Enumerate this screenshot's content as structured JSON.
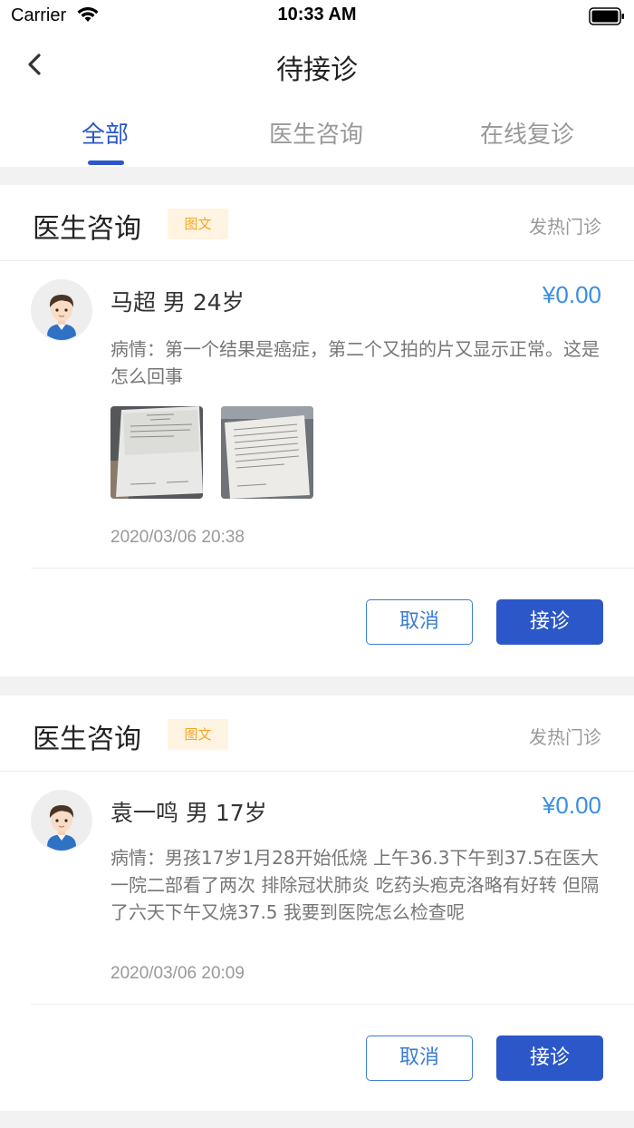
{
  "status": {
    "carrier": "Carrier",
    "time": "10:33 AM"
  },
  "nav": {
    "title": "待接诊",
    "back_icon": "chevron-left-icon"
  },
  "tabs": [
    {
      "label": "全部",
      "active": true
    },
    {
      "label": "医生咨询",
      "active": false
    },
    {
      "label": "在线复诊",
      "active": false
    }
  ],
  "colors": {
    "accent": "#2b57c8",
    "price": "#3a8ee6",
    "tag_bg": "#fff4e1",
    "tag_text": "#f5a623"
  },
  "cards": [
    {
      "type": "医生咨询",
      "tag": "图文",
      "department": "发热门诊",
      "patient": "马超 男 24岁",
      "price": "¥0.00",
      "condition": "病情：第一个结果是癌症，第二个又拍的片又显示正常。这是怎么回事",
      "datetime": "2020/03/06 20:38",
      "cancel_label": "取消",
      "accept_label": "接诊"
    },
    {
      "type": "医生咨询",
      "tag": "图文",
      "department": "发热门诊",
      "patient": "袁一鸣 男 17岁",
      "price": "¥0.00",
      "condition": "病情：男孩17岁1月28开始低烧 上午36.3下午到37.5在医大一院二部看了两次 排除冠状肺炎 吃药头疱克洛略有好转 但隔了六天下午又烧37.5 我要到医院怎么检查呢",
      "datetime": "2020/03/06 20:09",
      "cancel_label": "取消",
      "accept_label": "接诊"
    }
  ]
}
